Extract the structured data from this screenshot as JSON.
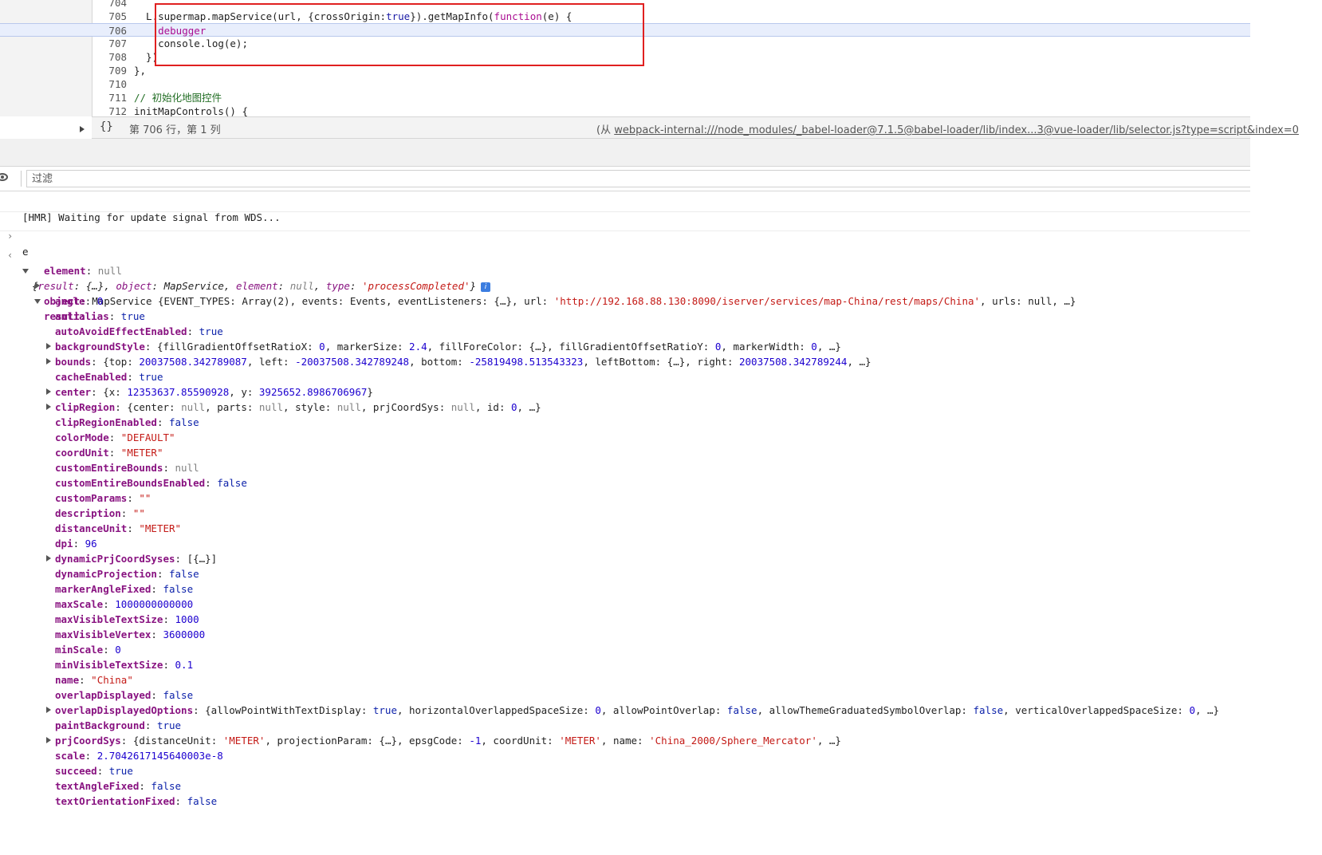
{
  "editor": {
    "lines": [
      {
        "num": "704",
        "text": ""
      },
      {
        "num": "705",
        "pre": "  L.supermap.mapService(url, {crossOrigin:",
        "bool": "true",
        "mid": "}).getMapInfo(",
        "fnkw": "function",
        "post": "(e) {"
      },
      {
        "num": "706",
        "kw": "    debugger"
      },
      {
        "num": "707",
        "text": "    console.log(e);"
      },
      {
        "num": "708",
        "text": "  })"
      },
      {
        "num": "709",
        "text": "},"
      },
      {
        "num": "710",
        "text": ""
      },
      {
        "num": "711",
        "comment": "// 初始化地图控件"
      },
      {
        "num": "712",
        "text": "initMapControls() {"
      }
    ]
  },
  "statusbar": {
    "braces": "{}",
    "cursor": "第 706 行，第 1 列",
    "source_prefix": "(从 ",
    "source_link": "webpack-internal:///node_modules/_babel-loader@7.1.5@babel-loader/lib/index...3@vue-loader/lib/selector.js?type=script&index=0"
  },
  "console_toolbar": {
    "filter_placeholder": "过滤"
  },
  "console": {
    "hmr_message": "[HMR] Waiting for update signal from WDS...",
    "input_expr": "e",
    "summary": {
      "k1": "result",
      "v1": "{…}",
      "k2": "object",
      "v2": "MapService",
      "k3": "element",
      "v3": "null",
      "k4": "type",
      "v4": "'processCompleted'"
    },
    "info_icon": "i",
    "element_key": "element",
    "element_val": "null",
    "object_key": "object",
    "object_preview_a": "MapService {EVENT_TYPES: Array(2), events: Events, eventListeners: {…}, url: ",
    "object_url": "'http://192.168.88.130:8090/iserver/services/map-China/rest/maps/China'",
    "object_preview_b": ", urls: null, …}",
    "result_key": "result:",
    "props": [
      {
        "k": "angle",
        "v": "0",
        "t": "num"
      },
      {
        "k": "antialias",
        "v": "true",
        "t": "bool"
      },
      {
        "k": "autoAvoidEffectEnabled",
        "v": "true",
        "t": "bool"
      },
      {
        "k": "backgroundStyle",
        "exp": true,
        "parts": [
          [
            "{fillGradientOffsetRatioX: ",
            "plain"
          ],
          [
            "0",
            "num"
          ],
          [
            ", markerSize: ",
            "plain"
          ],
          [
            "2.4",
            "num"
          ],
          [
            ", fillForeColor: {…}, fillGradientOffsetRatioY: ",
            "plain"
          ],
          [
            "0",
            "num"
          ],
          [
            ", markerWidth: ",
            "plain"
          ],
          [
            "0",
            "num"
          ],
          [
            ", …}",
            "plain"
          ]
        ]
      },
      {
        "k": "bounds",
        "exp": true,
        "parts": [
          [
            "{top: ",
            "plain"
          ],
          [
            "20037508.342789087",
            "num"
          ],
          [
            ", left: ",
            "plain"
          ],
          [
            "-20037508.342789248",
            "num"
          ],
          [
            ", bottom: ",
            "plain"
          ],
          [
            "-25819498.513543323",
            "num"
          ],
          [
            ", leftBottom: {…}, right: ",
            "plain"
          ],
          [
            "20037508.342789244",
            "num"
          ],
          [
            ", …}",
            "plain"
          ]
        ]
      },
      {
        "k": "cacheEnabled",
        "v": "true",
        "t": "bool"
      },
      {
        "k": "center",
        "exp": true,
        "parts": [
          [
            "{x: ",
            "plain"
          ],
          [
            "12353637.85590928",
            "num"
          ],
          [
            ", y: ",
            "plain"
          ],
          [
            "3925652.8986706967",
            "num"
          ],
          [
            "}",
            "plain"
          ]
        ]
      },
      {
        "k": "clipRegion",
        "exp": true,
        "parts": [
          [
            "{center: ",
            "plain"
          ],
          [
            "null",
            "null"
          ],
          [
            ", parts: ",
            "plain"
          ],
          [
            "null",
            "null"
          ],
          [
            ", style: ",
            "plain"
          ],
          [
            "null",
            "null"
          ],
          [
            ", prjCoordSys: ",
            "plain"
          ],
          [
            "null",
            "null"
          ],
          [
            ", id: ",
            "plain"
          ],
          [
            "0",
            "num"
          ],
          [
            ", …}",
            "plain"
          ]
        ]
      },
      {
        "k": "clipRegionEnabled",
        "v": "false",
        "t": "bool"
      },
      {
        "k": "colorMode",
        "v": "\"DEFAULT\"",
        "t": "str"
      },
      {
        "k": "coordUnit",
        "v": "\"METER\"",
        "t": "str"
      },
      {
        "k": "customEntireBounds",
        "v": "null",
        "t": "null"
      },
      {
        "k": "customEntireBoundsEnabled",
        "v": "false",
        "t": "bool"
      },
      {
        "k": "customParams",
        "v": "\"\"",
        "t": "str"
      },
      {
        "k": "description",
        "v": "\"\"",
        "t": "str"
      },
      {
        "k": "distanceUnit",
        "v": "\"METER\"",
        "t": "str"
      },
      {
        "k": "dpi",
        "v": "96",
        "t": "num"
      },
      {
        "k": "dynamicPrjCoordSyses",
        "exp": true,
        "parts": [
          [
            "[{…}]",
            "plain"
          ]
        ]
      },
      {
        "k": "dynamicProjection",
        "v": "false",
        "t": "bool"
      },
      {
        "k": "markerAngleFixed",
        "v": "false",
        "t": "bool"
      },
      {
        "k": "maxScale",
        "v": "1000000000000",
        "t": "num"
      },
      {
        "k": "maxVisibleTextSize",
        "v": "1000",
        "t": "num"
      },
      {
        "k": "maxVisibleVertex",
        "v": "3600000",
        "t": "num"
      },
      {
        "k": "minScale",
        "v": "0",
        "t": "num"
      },
      {
        "k": "minVisibleTextSize",
        "v": "0.1",
        "t": "num"
      },
      {
        "k": "name",
        "v": "\"China\"",
        "t": "str"
      },
      {
        "k": "overlapDisplayed",
        "v": "false",
        "t": "bool"
      },
      {
        "k": "overlapDisplayedOptions",
        "exp": true,
        "parts": [
          [
            "{allowPointWithTextDisplay: ",
            "plain"
          ],
          [
            "true",
            "bool"
          ],
          [
            ", horizontalOverlappedSpaceSize: ",
            "plain"
          ],
          [
            "0",
            "num"
          ],
          [
            ", allowPointOverlap: ",
            "plain"
          ],
          [
            "false",
            "bool"
          ],
          [
            ", allowThemeGraduatedSymbolOverlap: ",
            "plain"
          ],
          [
            "false",
            "bool"
          ],
          [
            ", verticalOverlappedSpaceSize: ",
            "plain"
          ],
          [
            "0",
            "num"
          ],
          [
            ", …}",
            "plain"
          ]
        ]
      },
      {
        "k": "paintBackground",
        "v": "true",
        "t": "bool"
      },
      {
        "k": "prjCoordSys",
        "exp": true,
        "parts": [
          [
            "{distanceUnit: ",
            "plain"
          ],
          [
            "'METER'",
            "str"
          ],
          [
            ", projectionParam: {…}, epsgCode: ",
            "plain"
          ],
          [
            "-1",
            "num"
          ],
          [
            ", coordUnit: ",
            "plain"
          ],
          [
            "'METER'",
            "str"
          ],
          [
            ", name: ",
            "plain"
          ],
          [
            "'China_2000/Sphere_Mercator'",
            "str"
          ],
          [
            ", …}",
            "plain"
          ]
        ]
      },
      {
        "k": "scale",
        "v": "2.7042617145640003e-8",
        "t": "num"
      },
      {
        "k": "succeed",
        "v": "true",
        "t": "bool"
      },
      {
        "k": "textAngleFixed",
        "v": "false",
        "t": "bool"
      },
      {
        "k": "textOrientationFixed",
        "v": "false",
        "t": "bool"
      }
    ]
  }
}
